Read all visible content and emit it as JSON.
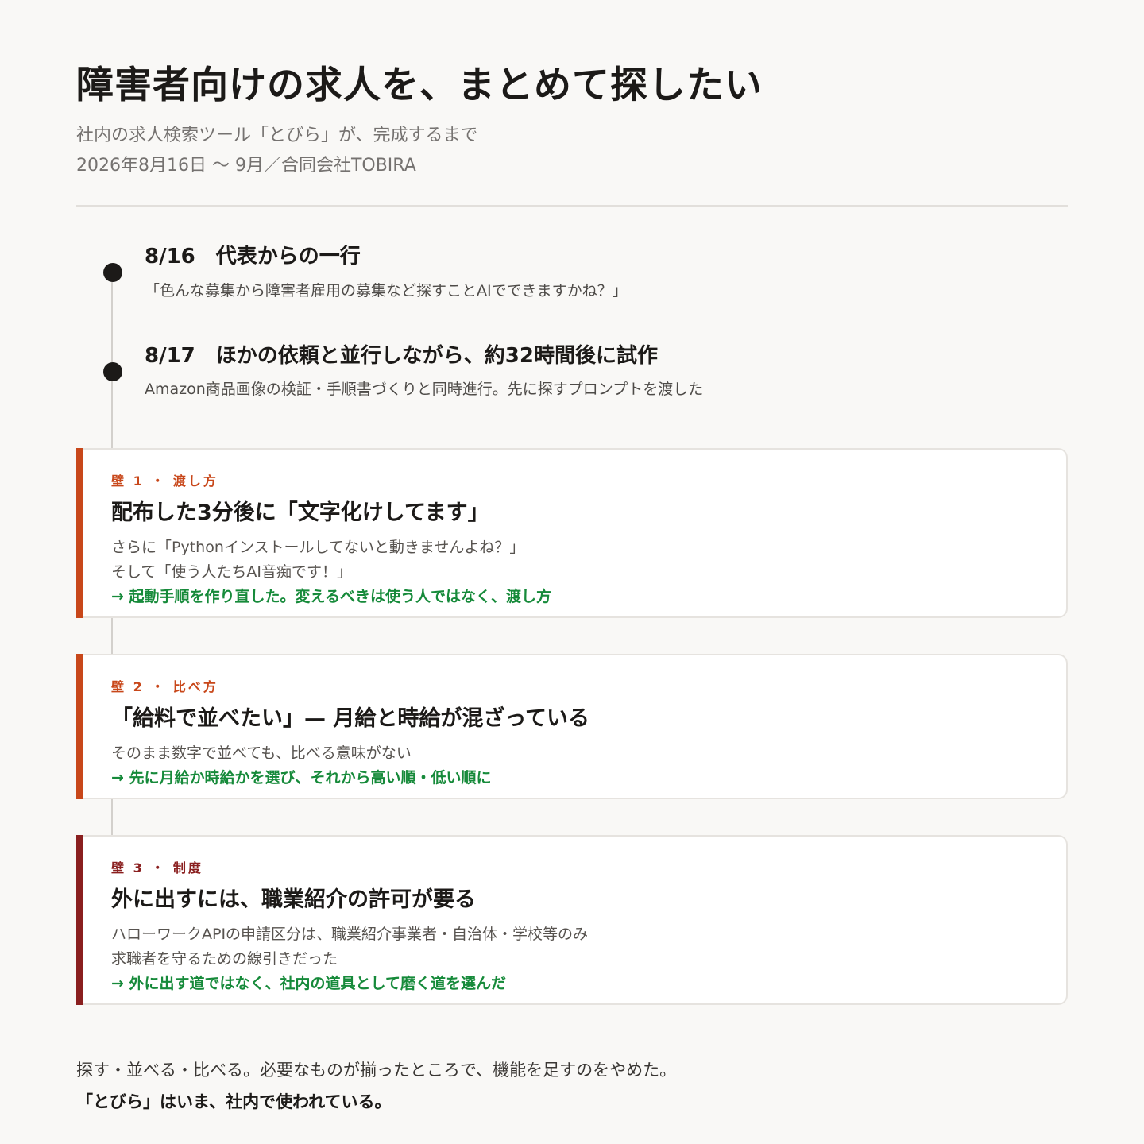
{
  "header": {
    "title": "障害者向けの求人を、まとめて探したい",
    "subtitle": "社内の求人検索ツール「とびら」が、完成するまで",
    "meta": "2026年8月16日 〜 9月／合同会社TOBIRA"
  },
  "timeline": {
    "events": [
      {
        "heading": "8/16　代表からの一行",
        "body": "「色んな募集から障害者雇用の募集など探すことAIでできますかね？」"
      },
      {
        "heading": "8/17　ほかの依頼と並行しながら、約32時間後に試作",
        "body": "Amazon商品画像の検証・手順書づくりと同時進行。先に探すプロンプトを渡した"
      }
    ],
    "walls": [
      {
        "tag": "壁 1 ・ 渡し方",
        "title": "配布した3分後に「文字化けしてます」",
        "lines": [
          "さらに「Pythonインストールしてないと動きませんよね？」",
          "そして「使う人たちAI音痴です！」"
        ],
        "conclusion": "→ 起動手順を作り直した。変えるべきは使う人ではなく、渡し方",
        "accent_color": "#c8471a"
      },
      {
        "tag": "壁 2 ・ 比べ方",
        "title": "「給料で並べたい」— 月給と時給が混ざっている",
        "lines": [
          "そのまま数字で並べても、比べる意味がない"
        ],
        "conclusion": "→ 先に月給か時給かを選び、それから高い順・低い順に",
        "accent_color": "#c8471a"
      },
      {
        "tag": "壁 3 ・ 制度",
        "title": "外に出すには、職業紹介の許可が要る",
        "lines": [
          "ハローワークAPIの申請区分は、職業紹介事業者・自治体・学校等のみ",
          "求職者を守るための線引きだった"
        ],
        "conclusion": "→ 外に出す道ではなく、社内の道具として磨く道を選んだ",
        "accent_color": "#8a1f1f"
      }
    ]
  },
  "footer": {
    "line1": "探す・並べる・比べる。必要なものが揃ったところで、機能を足すのをやめた。",
    "line2": "「とびら」はいま、社内で使われている。"
  },
  "colors": {
    "background": "#f9f8f6",
    "text": "#1c1a18",
    "muted": "#757270",
    "conclusion_green": "#168a3a"
  }
}
